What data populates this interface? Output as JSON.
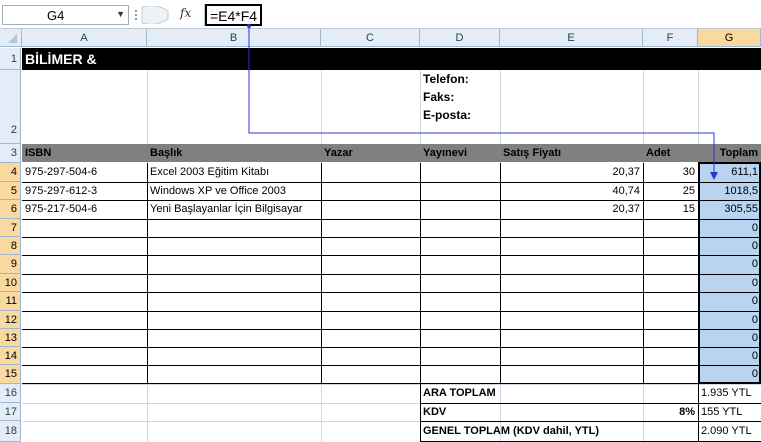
{
  "formula_bar": {
    "name_box": "G4",
    "fx": "fx",
    "formula": "=E4*F4"
  },
  "columns": [
    "A",
    "B",
    "C",
    "D",
    "E",
    "F",
    "G"
  ],
  "rows": [
    "1",
    "2",
    "3",
    "4",
    "5",
    "6",
    "7",
    "8",
    "9",
    "10",
    "11",
    "12",
    "13",
    "14",
    "15",
    "16",
    "17",
    "18"
  ],
  "title": "BİLİMER & NEW HORİZONS",
  "contact": {
    "phone_label": "Telefon:",
    "fax_label": "Faks:",
    "email_label": "E-posta:"
  },
  "headers": {
    "isbn": "ISBN",
    "title": "Başlık",
    "author": "Yazar",
    "publisher": "Yayınevi",
    "price": "Satış Fiyatı",
    "qty": "Adet",
    "total": "Toplam"
  },
  "items": [
    {
      "isbn": "975-297-504-6",
      "title": "Excel 2003 Eğitim Kitabı",
      "price": "20,37",
      "qty": "30",
      "total": "611,1"
    },
    {
      "isbn": "975-297-612-3",
      "title": "Windows XP ve Office 2003",
      "price": "40,74",
      "qty": "25",
      "total": "1018,5"
    },
    {
      "isbn": "975-217-504-6",
      "title": "Yeni Başlayanlar İçin Bilgisayar",
      "price": "20,37",
      "qty": "15",
      "total": "305,55"
    }
  ],
  "empty_totals": [
    "0",
    "0",
    "0",
    "0",
    "0",
    "0",
    "0",
    "0",
    "0"
  ],
  "summary": {
    "subtotal_label": "ARA TOPLAM",
    "subtotal_value": "1.935 YTL",
    "kdv_label": "KDV",
    "kdv_rate": "8%",
    "kdv_value": "155 YTL",
    "grand_label": "GENEL TOPLAM (KDV dahil, YTL)",
    "grand_value": "2.090 YTL"
  },
  "colors": {
    "selection_blue": "#b8d4f0",
    "trace_arrow": "#2a36d8",
    "header_gray": "#808080",
    "title_bg": "#000000"
  }
}
